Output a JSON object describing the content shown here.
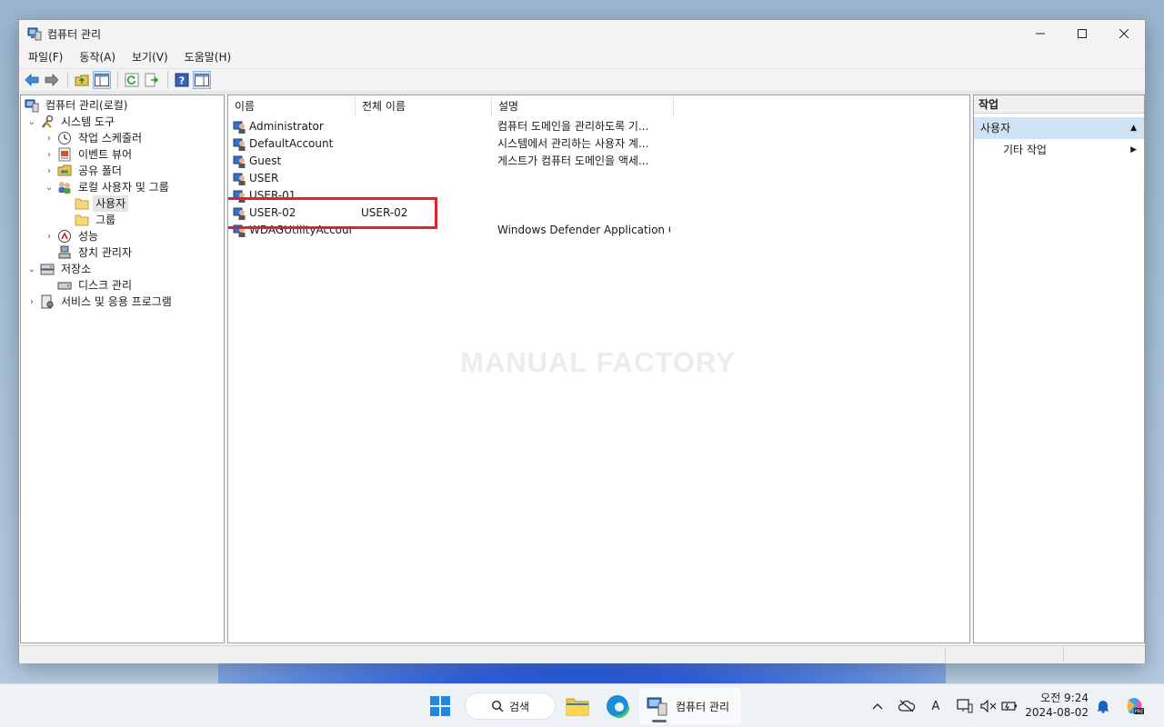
{
  "window": {
    "title": "컴퓨터 관리",
    "menu": [
      "파일(F)",
      "동작(A)",
      "보기(V)",
      "도움말(H)"
    ]
  },
  "tree": {
    "root": "컴퓨터 관리(로컬)",
    "items": [
      {
        "label": "시스템 도구",
        "level": 1,
        "expanded": true
      },
      {
        "label": "작업 스케줄러",
        "level": 2
      },
      {
        "label": "이벤트 뷰어",
        "level": 2
      },
      {
        "label": "공유 폴더",
        "level": 2
      },
      {
        "label": "로컬 사용자 및 그룹",
        "level": 2,
        "expanded": true
      },
      {
        "label": "사용자",
        "level": 3,
        "selected": true
      },
      {
        "label": "그룹",
        "level": 3
      },
      {
        "label": "성능",
        "level": 2
      },
      {
        "label": "장치 관리자",
        "level": 2
      },
      {
        "label": "저장소",
        "level": 1,
        "expanded": true
      },
      {
        "label": "디스크 관리",
        "level": 2
      },
      {
        "label": "서비스 및 응용 프로그램",
        "level": 1
      }
    ]
  },
  "list": {
    "columns": [
      "이름",
      "전체 이름",
      "설명"
    ],
    "rows": [
      {
        "name": "Administrator",
        "full_name": "",
        "description": "컴퓨터 도메인을 관리하도록 기..."
      },
      {
        "name": "DefaultAccount",
        "full_name": "",
        "description": "시스템에서 관리하는 사용자 계..."
      },
      {
        "name": "Guest",
        "full_name": "",
        "description": "게스트가 컴퓨터 도메인을 액세..."
      },
      {
        "name": "USER",
        "full_name": "",
        "description": ""
      },
      {
        "name": "USER-01",
        "full_name": "",
        "description": ""
      },
      {
        "name": "USER-02",
        "full_name": "USER-02",
        "description": ""
      },
      {
        "name": "WDAGUtilityAccount",
        "full_name": "",
        "description": "Windows Defender Application G..."
      }
    ],
    "watermark": "MANUAL FACTORY",
    "highlight_color": "#e0242a"
  },
  "actions": {
    "header": "작업",
    "section": "사용자",
    "items": [
      "기타 작업"
    ]
  },
  "taskbar": {
    "search_label": "검색",
    "active_app": "컴퓨터 관리",
    "clock_time": "오전 9:24",
    "clock_date": "2024-08-02",
    "tray_ime": "A"
  },
  "colors": {
    "selection": "#cfe3f5",
    "accent": "#2b5fe2"
  }
}
